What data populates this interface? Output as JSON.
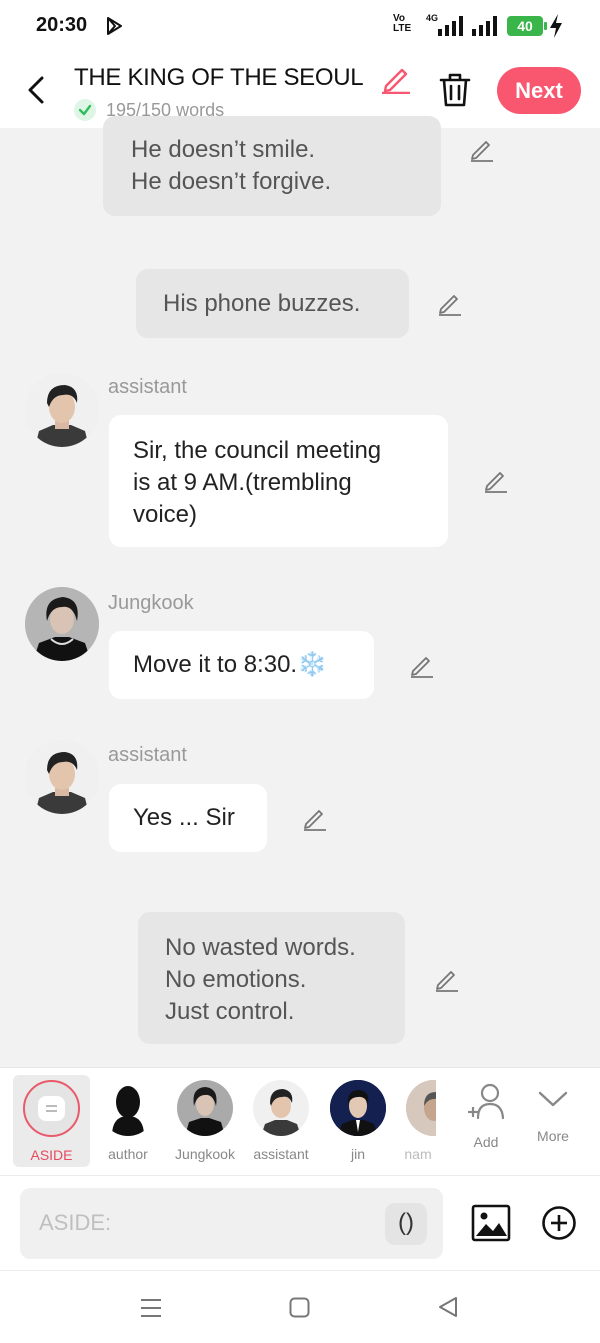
{
  "status_bar": {
    "time": "20:30",
    "volte_top": "Vo",
    "volte_bottom": "LTE",
    "network": "4G",
    "battery": "40"
  },
  "header": {
    "title": "THE KING OF THE SEOUL",
    "word_count": "195/150 words",
    "next_label": "Next"
  },
  "messages": [
    {
      "type": "narration",
      "lines": [
        "He doesn’t smile.",
        "He doesn’t forgive."
      ]
    },
    {
      "type": "narration",
      "lines": [
        "His phone buzzes."
      ]
    },
    {
      "type": "character",
      "speaker": "assistant",
      "lines": [
        "Sir, the council meeting",
        "is at 9 AM.(trembling",
        "voice)"
      ]
    },
    {
      "type": "character",
      "speaker": "Jungkook",
      "lines": [
        "Move it to 8:30."
      ],
      "emoji": "❄️"
    },
    {
      "type": "character",
      "speaker": "assistant",
      "lines": [
        "Yes ... Sir"
      ]
    },
    {
      "type": "narration",
      "lines": [
        "No wasted words.",
        "No emotions.",
        "Just control."
      ]
    }
  ],
  "characters": {
    "aside": "ASIDE",
    "author": "author",
    "jungkook": "Jungkook",
    "assistant": "assistant",
    "jin": "jin",
    "nam": "nam",
    "add": "Add",
    "more": "More"
  },
  "input": {
    "placeholder": "ASIDE:",
    "paren": "()"
  },
  "colors": {
    "accent": "#f8576f",
    "aside_ring": "#e95a6b",
    "battery": "#39b54a",
    "background": "#f2f2f2"
  }
}
